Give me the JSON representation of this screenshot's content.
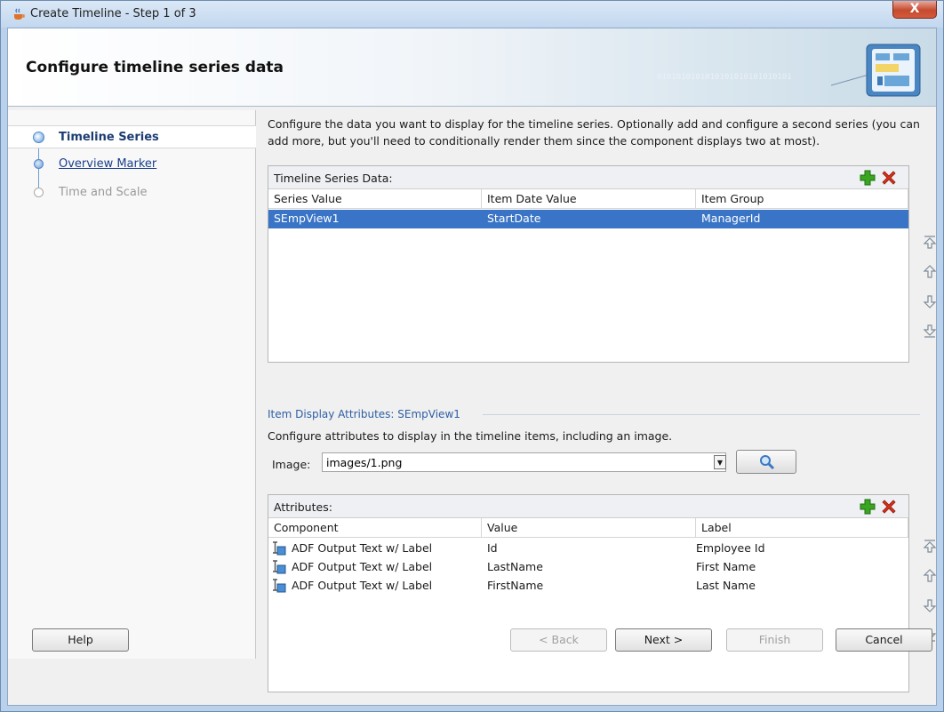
{
  "window": {
    "title": "Create Timeline - Step 1 of 3",
    "close_label": "X"
  },
  "header": {
    "title": "Configure timeline series data",
    "binary_text": "0101010101010101010101010101"
  },
  "nav": {
    "items": [
      {
        "label": "Timeline Series",
        "state": "active"
      },
      {
        "label": "Overview Marker",
        "state": "link"
      },
      {
        "label": "Time and Scale",
        "state": "disabled"
      }
    ]
  },
  "main": {
    "description": "Configure the data you want to display for the timeline series. Optionally add and configure a second series (you can add more, but you'll need to conditionally render them since the component displays two at most).",
    "series_panel": {
      "label": "Timeline Series Data:",
      "columns": [
        "Series Value",
        "Item Date Value",
        "Item Group"
      ],
      "rows": [
        {
          "series": "SEmpView1",
          "date": "StartDate",
          "group": "ManagerId",
          "selected": true
        }
      ]
    },
    "item_section_label": "Item Display Attributes: SEmpView1",
    "item_description": "Configure attributes to display in the timeline items, including an image.",
    "image": {
      "label": "Image:",
      "value": "images/1.png"
    },
    "attributes_panel": {
      "label": "Attributes:",
      "columns": [
        "Component",
        "Value",
        "Label"
      ],
      "rows": [
        {
          "component": "ADF Output Text w/ Label",
          "value": "Id",
          "label": "Employee Id"
        },
        {
          "component": "ADF Output Text w/ Label",
          "value": "LastName",
          "label": "First Name"
        },
        {
          "component": "ADF Output Text w/ Label",
          "value": "FirstName",
          "label": "Last Name"
        }
      ]
    }
  },
  "footer": {
    "help": "Help",
    "back": "< Back",
    "next": "Next >",
    "finish": "Finish",
    "cancel": "Cancel"
  },
  "colors": {
    "selection": "#3974c6",
    "nav_active": "#1d3d72",
    "link": "#1a3f8a",
    "add_icon": "#2f9a1b",
    "delete_icon": "#d6311b"
  }
}
